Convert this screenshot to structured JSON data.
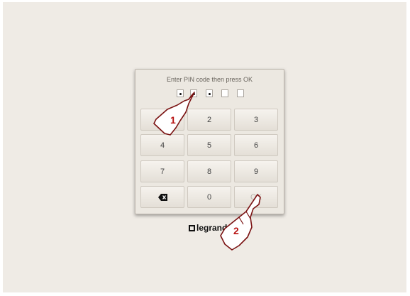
{
  "dialog": {
    "prompt": "Enter PIN code then press OK",
    "pin_digits": [
      {
        "filled": true
      },
      {
        "filled": true
      },
      {
        "filled": true
      },
      {
        "filled": false
      },
      {
        "filled": false
      }
    ]
  },
  "keypad": {
    "keys": [
      "1",
      "2",
      "3",
      "4",
      "5",
      "6",
      "7",
      "8",
      "9",
      "",
      "0",
      "OK"
    ]
  },
  "brand": {
    "logo_text": "legrand"
  },
  "annotations": {
    "step1": "1",
    "step2": "2"
  }
}
